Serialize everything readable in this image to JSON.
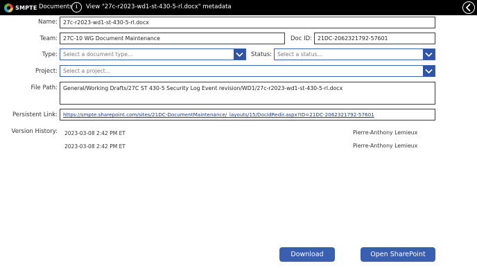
{
  "header": {
    "logo_text": "SMPTE",
    "nav_documents": "Documents",
    "info_glyph": "i",
    "view_title": "View \"27c-r2023-wd1-st-430-5-rl.docx\" metadata",
    "back_icon": "chevron-left-icon"
  },
  "form": {
    "name_label": "Name:",
    "name_value": "27c-r2023-wd1-st-430-5-rl.docx",
    "team_label": "Team:",
    "team_value": "27C-10 WG Document Maintenance",
    "docid_label": "Doc ID:",
    "docid_value": "21DC-2062321792-57601",
    "type_label": "Type:",
    "type_placeholder": "Select a document type...",
    "status_label": "Status:",
    "status_placeholder": "Select a status...",
    "project_label": "Project:",
    "project_placeholder": "Select a project...",
    "filepath_label": "File Path:",
    "filepath_value": "General/Working Drafts/27C ST 430-5 Security Log Event revision/WD1/27c-r2023-wd1-st-430-5-rl.docx",
    "link_label": "Persistent Link:",
    "link_value": "https://smpte.sharepoint.com/sites/21DC-DocumentMaintenance/_layouts/15/DocIdRedir.aspx?ID=21DC-2062321792-57601"
  },
  "version_history": {
    "label": "Version History:",
    "entries": [
      {
        "date": "2023-03-08 2:42 PM ET",
        "user": "Pierre-Anthony Lemieux"
      },
      {
        "date": "2023-03-08 2:42 PM ET",
        "user": "Pierre-Anthony Lemieux"
      }
    ]
  },
  "actions": {
    "download": "Download",
    "open_sharepoint": "Open SharePoint"
  },
  "colors": {
    "accent": "#3a5fb0",
    "topbar": "#000000"
  }
}
